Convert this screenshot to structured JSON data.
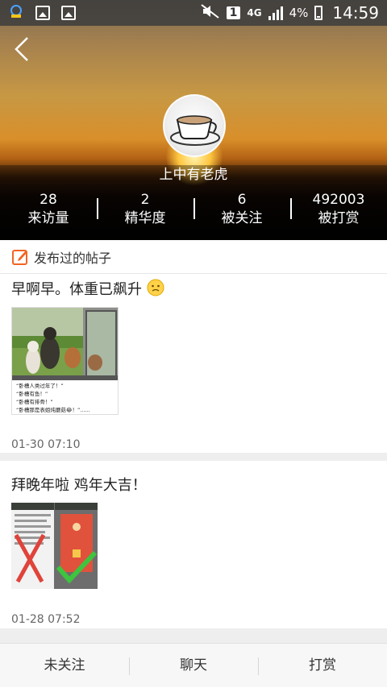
{
  "status_bar": {
    "battery": "4%",
    "time": "14:59",
    "network": "4G",
    "sim": "1"
  },
  "profile": {
    "username": "上中有老虎"
  },
  "stats": [
    {
      "value": "28",
      "label": "来访量"
    },
    {
      "value": "2",
      "label": "精华度"
    },
    {
      "value": "6",
      "label": "被关注"
    },
    {
      "value": "492003",
      "label": "被打赏"
    }
  ],
  "section": {
    "title": "发布过的帖子"
  },
  "posts": [
    {
      "text": "早啊早。体重已飙升",
      "time": "01-30 07:10",
      "captions": [
        "“卧槽人类过年了！”",
        "“卧槽有鱼！”",
        "“卧槽有排骨！”",
        "“卧槽那是表姐炖蘑菇😂！”......"
      ]
    },
    {
      "text": "拜晚年啦 鸡年大吉！",
      "time": "01-28 07:52"
    }
  ],
  "bottom_bar": {
    "follow": "未关注",
    "chat": "聊天",
    "reward": "打赏"
  },
  "colors": {
    "accent": "#f26522",
    "divider": "#eeeeee"
  }
}
